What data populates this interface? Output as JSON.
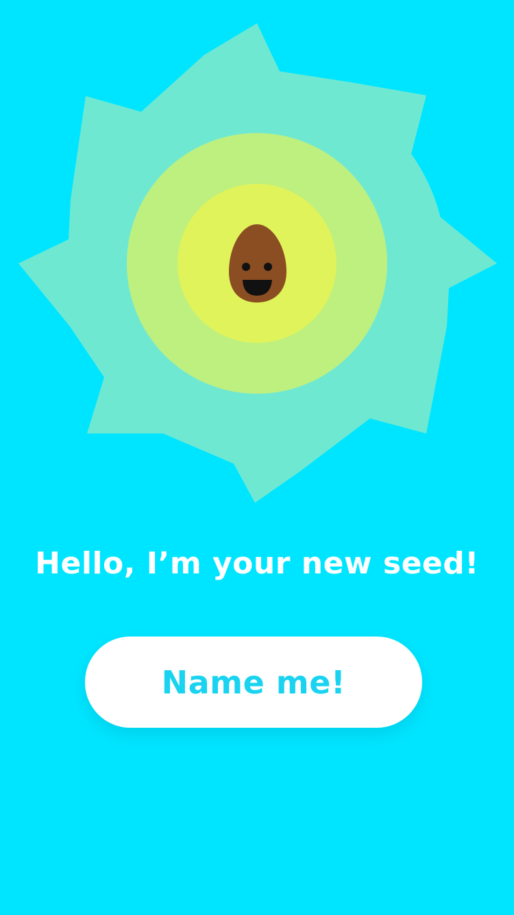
{
  "onboarding": {
    "greeting": "Hello, I’m your new seed!",
    "name_button_label": "Name me!"
  },
  "colors": {
    "background": "#00e5ff",
    "sun_outer": "#6fe8d2",
    "sun_middle": "#bdf07f",
    "sun_inner": "#e0f35a",
    "seed": "#8b4d22",
    "seed_face": "#111111",
    "button_background": "#ffffff",
    "button_text": "#1ad3f0",
    "greeting_text": "#ffffff"
  },
  "icons": {
    "sun": "sunburst-icon",
    "seed": "smiling-seed-icon"
  }
}
